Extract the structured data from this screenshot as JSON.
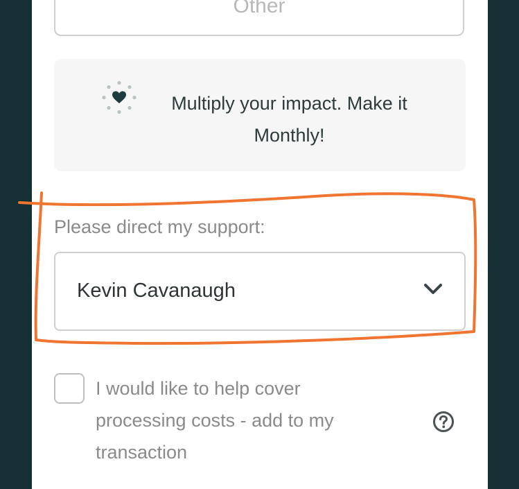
{
  "amount": {
    "other_label": "Other"
  },
  "monthly": {
    "icon": "heart-sparkle-icon",
    "text": "Multiply your impact. Make it Monthly!"
  },
  "direct_support": {
    "label": "Please direct my support:",
    "selected": "Kevin Cavanaugh"
  },
  "processing_costs": {
    "label": "I would like to help cover processing costs - add to my transaction",
    "checked": false
  },
  "colors": {
    "background": "#143034",
    "annotation": "#ef7531",
    "heart": "#1e3c40"
  }
}
